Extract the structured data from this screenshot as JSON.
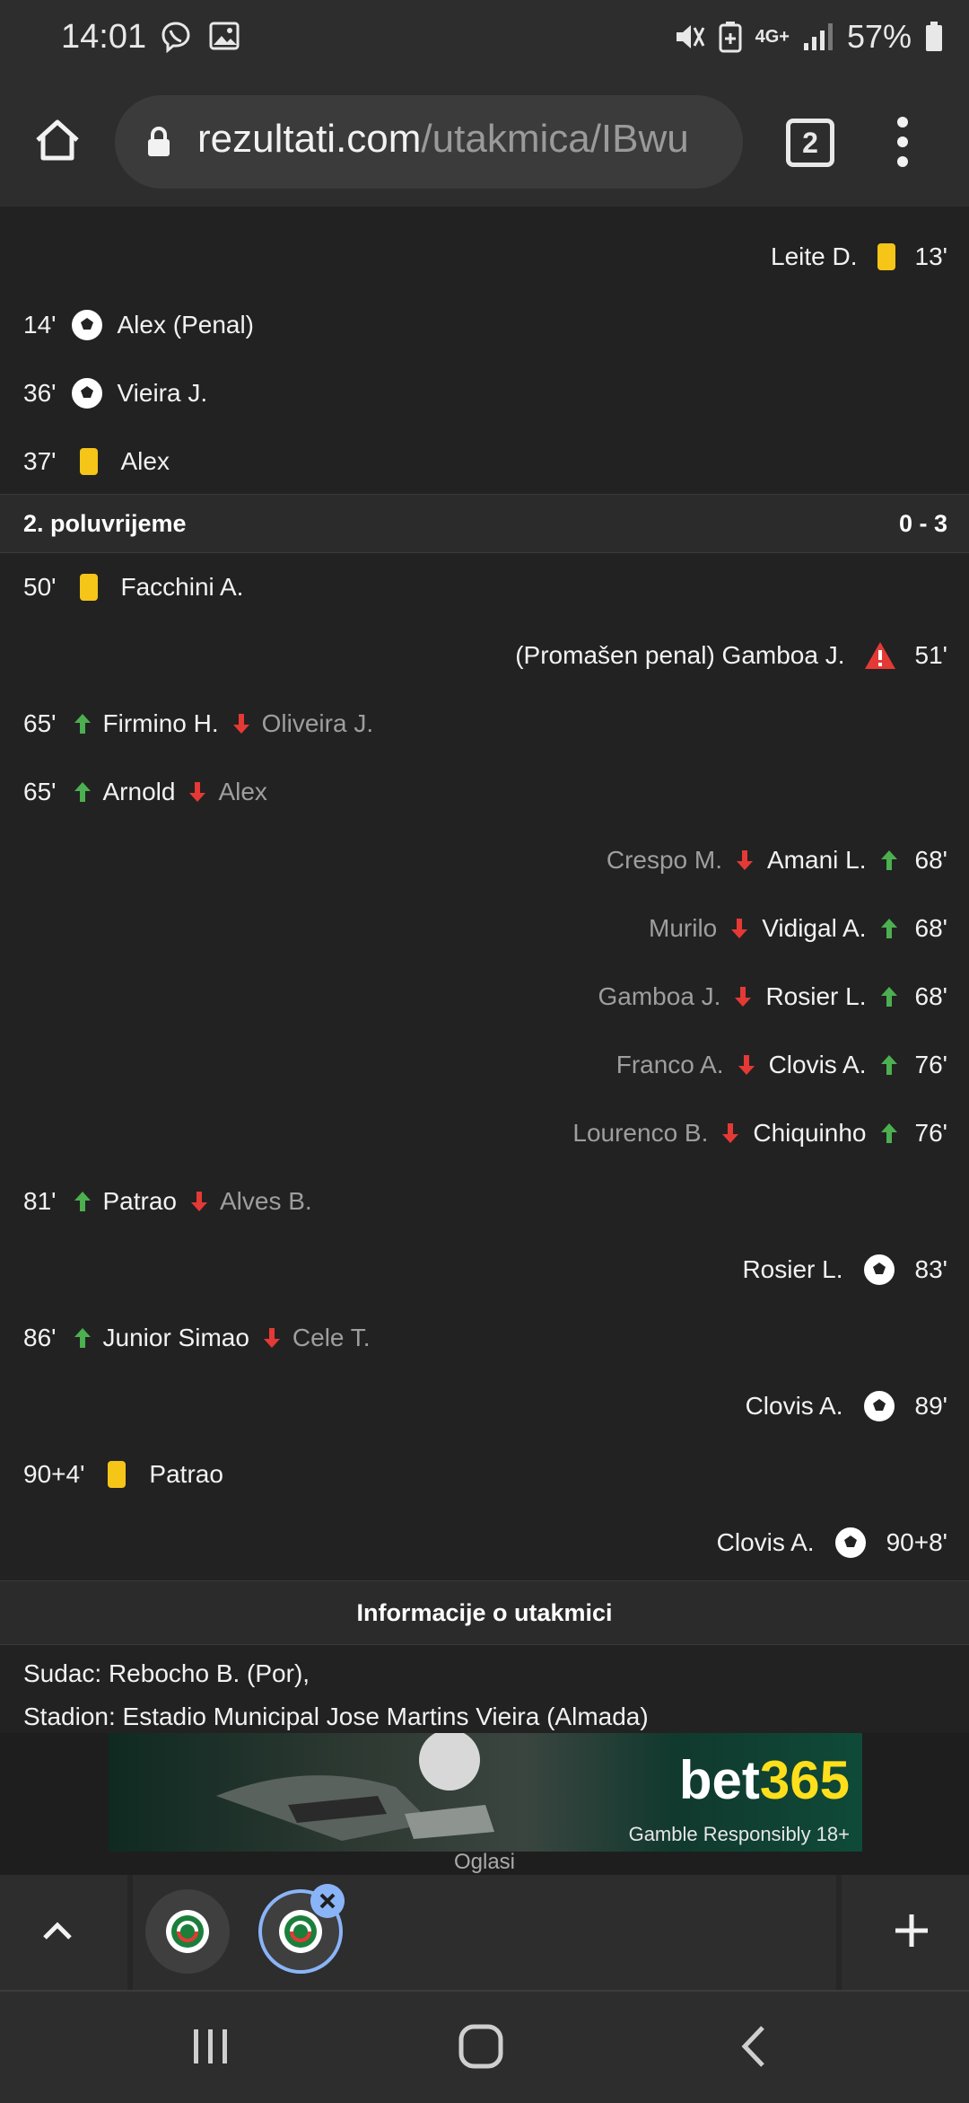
{
  "status": {
    "time": "14:01",
    "network": "4G+",
    "battery": "57%",
    "icons": [
      "viber-icon",
      "gallery-icon",
      "mute-icon",
      "battery-saver-icon",
      "signal-icon",
      "battery-icon"
    ]
  },
  "browser": {
    "url_domain": "rezultati.com",
    "url_path": "/utakmica/IBwu",
    "tab_count": "2"
  },
  "events_top": [
    {
      "side": "right",
      "minute": "13'",
      "type": "yellow-card",
      "player": "Leite D."
    },
    {
      "side": "left",
      "minute": "14'",
      "type": "goal",
      "player": "Alex (Penal)"
    },
    {
      "side": "left",
      "minute": "36'",
      "type": "goal",
      "player": "Vieira J."
    },
    {
      "side": "left",
      "minute": "37'",
      "type": "yellow-card",
      "player": "Alex"
    }
  ],
  "second_half": {
    "label": "2. poluvrijeme",
    "score": "0 - 3"
  },
  "events_second": [
    {
      "side": "left",
      "minute": "50'",
      "type": "yellow-card",
      "player": "Facchini A."
    },
    {
      "side": "right",
      "minute": "51'",
      "type": "missed-penalty",
      "player": "(Promašen penal) Gamboa J."
    },
    {
      "side": "left",
      "minute": "65'",
      "type": "sub",
      "player_in": "Firmino H.",
      "player_out": "Oliveira J."
    },
    {
      "side": "left",
      "minute": "65'",
      "type": "sub",
      "player_in": "Arnold",
      "player_out": "Alex"
    },
    {
      "side": "right",
      "minute": "68'",
      "type": "sub",
      "player_in": "Amani L.",
      "player_out": "Crespo M."
    },
    {
      "side": "right",
      "minute": "68'",
      "type": "sub",
      "player_in": "Vidigal A.",
      "player_out": "Murilo"
    },
    {
      "side": "right",
      "minute": "68'",
      "type": "sub",
      "player_in": "Rosier L.",
      "player_out": "Gamboa J."
    },
    {
      "side": "right",
      "minute": "76'",
      "type": "sub",
      "player_in": "Clovis A.",
      "player_out": "Franco A."
    },
    {
      "side": "right",
      "minute": "76'",
      "type": "sub",
      "player_in": "Chiquinho",
      "player_out": "Lourenco B."
    },
    {
      "side": "left",
      "minute": "81'",
      "type": "sub",
      "player_in": "Patrao",
      "player_out": "Alves B."
    },
    {
      "side": "right",
      "minute": "83'",
      "type": "goal",
      "player": "Rosier L."
    },
    {
      "side": "left",
      "minute": "86'",
      "type": "sub",
      "player_in": "Junior Simao",
      "player_out": "Cele T."
    },
    {
      "side": "right",
      "minute": "89'",
      "type": "goal",
      "player": "Clovis A."
    },
    {
      "side": "left",
      "minute": "90+4'",
      "type": "yellow-card",
      "player": "Patrao"
    },
    {
      "side": "right",
      "minute": "90+8'",
      "type": "goal",
      "player": "Clovis A."
    }
  ],
  "match_info": {
    "title": "Informacije o utakmici",
    "referee": "Sudac: Rebocho B. (Por),",
    "stadium": "Stadion: Estadio Municipal Jose Martins Vieira (Almada)"
  },
  "ad": {
    "brand_a": "bet",
    "brand_b": "365",
    "subtext": "Gamble Responsibly  18+",
    "label": "Oglasi"
  },
  "colors": {
    "background": "#222222",
    "yellow_card": "#f5c518",
    "sub_in": "#4caf50",
    "sub_out": "#e53935",
    "warning": "#e53935",
    "active_tab": "#8ab4f8"
  }
}
